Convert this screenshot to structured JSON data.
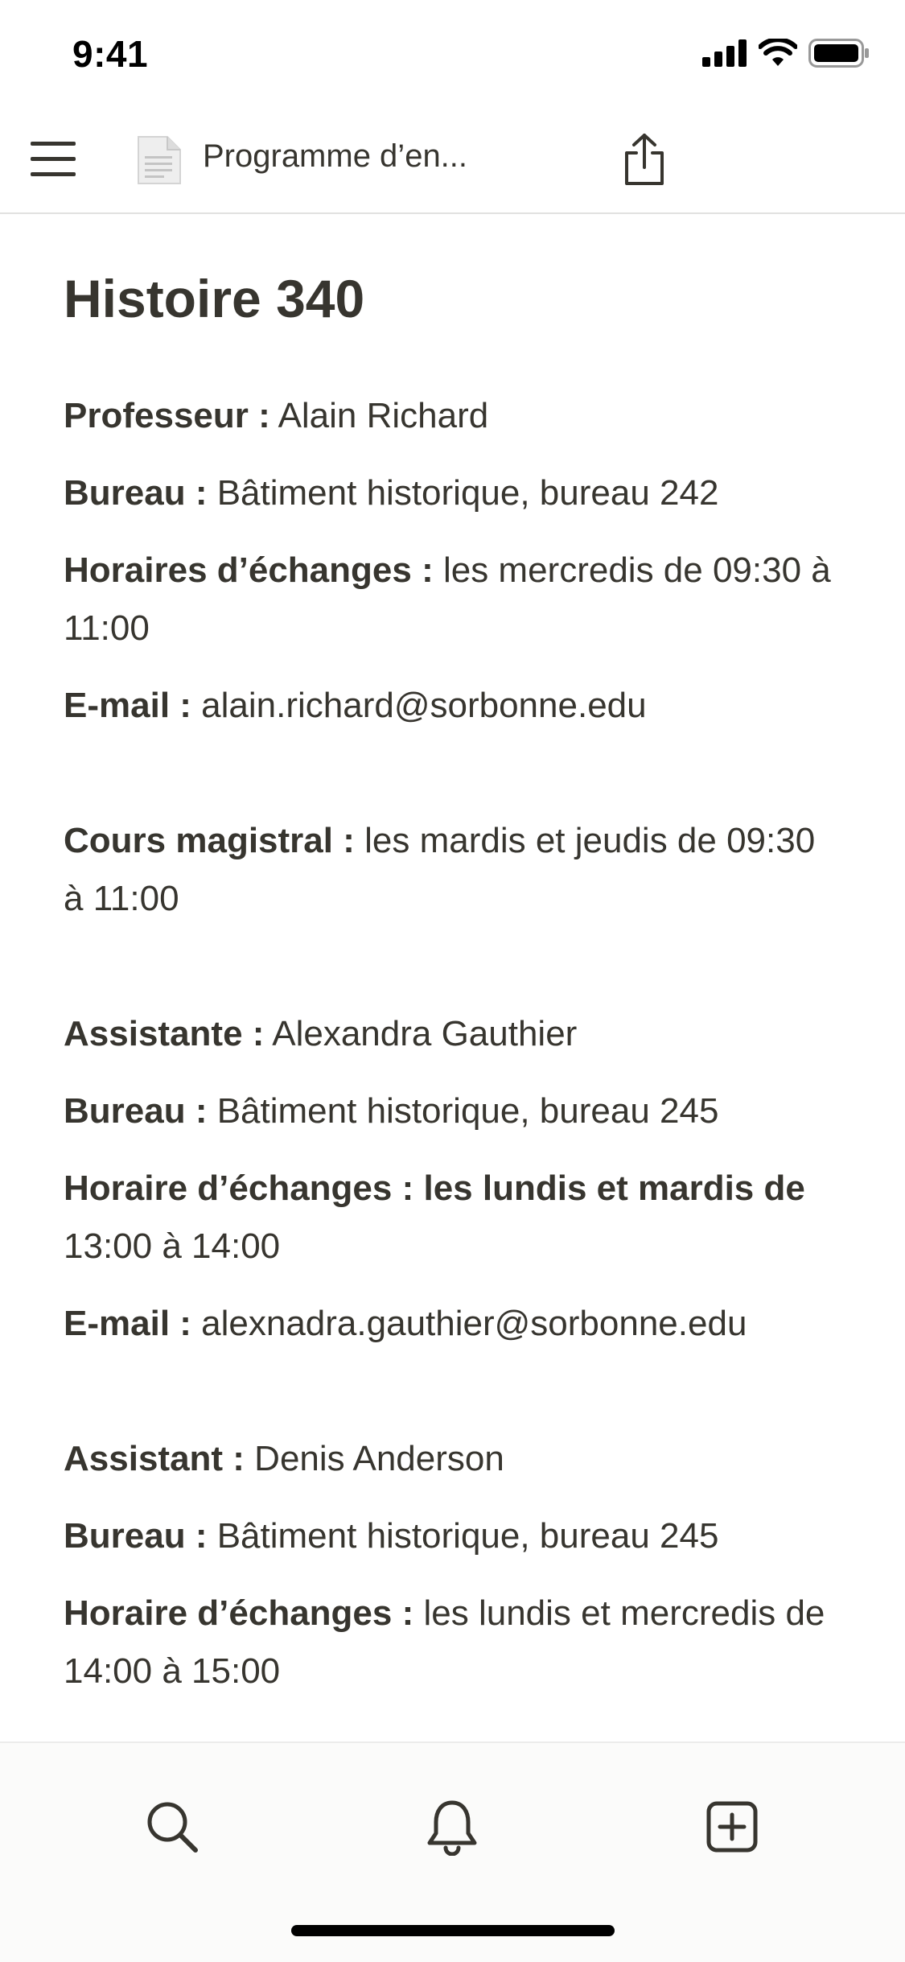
{
  "status_bar": {
    "time": "9:41"
  },
  "header": {
    "title": "Programme d’en..."
  },
  "page": {
    "title": "Histoire 340",
    "professor": {
      "name_label": "Professeur :",
      "name_value": " Alain Richard",
      "office_label": "Bureau :",
      "office_value": " Bâtiment historique, bureau 242",
      "hours_label": "Horaires d’échanges :",
      "hours_value": " les mercredis de 09:30 à 11:00",
      "email_label": "E-mail :",
      "email_value": " alain.richard@sorbonne.edu"
    },
    "lecture": {
      "label": "Cours magistral :",
      "value": " les mardis et jeudis de 09:30 à 11:00"
    },
    "assistant1": {
      "name_label": "Assistante :",
      "name_value": " Alexandra Gauthier",
      "office_label": "Bureau :",
      "office_value": " Bâtiment historique, bureau 245",
      "hours_label": "Horaire d’échanges : les lundis et mardis de",
      "hours_value": " 13:00 à 14:00",
      "email_label": "E-mail :",
      "email_value": " alexnadra.gauthier@sorbonne.edu"
    },
    "assistant2": {
      "name_label": "Assistant :",
      "name_value": " Denis Anderson",
      "office_label": "Bureau :",
      "office_value": " Bâtiment historique, bureau 245",
      "hours_label": "Horaire d’échanges :",
      "hours_value": " les lundis et mercredis de 14:00 à 15:00"
    }
  },
  "tab_bar": {
    "icons": [
      "search-icon",
      "bell-icon",
      "new-page-icon"
    ]
  }
}
